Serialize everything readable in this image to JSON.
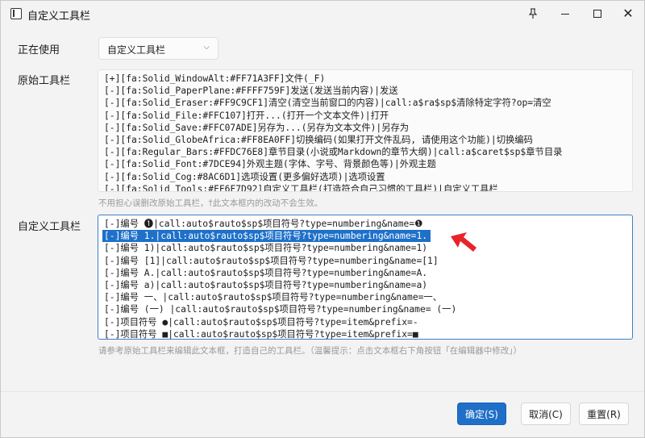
{
  "window": {
    "title": "自定义工具栏"
  },
  "form": {
    "in_use_label": "正在使用",
    "in_use_value": "自定义工具栏",
    "original_label": "原始工具栏",
    "original_lines": [
      "[+][fa:Solid_WindowAlt:#FF71A3FF]文件(_F)",
      "[-][fa:Solid_PaperPlane:#FFFF759F]发送(发送当前内容)|发送",
      "[-][fa:Solid_Eraser:#FF9C9CF1]清空(清空当前窗口的内容)|call:a$ra$sp$清除特定字符?op=清空",
      "[-][fa:Solid_File:#FFC107]打开...(打开一个文本文件)|打开",
      "[-][fa:Solid_Save:#FFC07ADE]另存为...(另存为文本文件)|另存为",
      "[-][fa:Solid_GlobeAfrica:#FF8EA0FF]切换编码(如果打开文件乱码, 请使用这个功能)|切换编码",
      "[-][fa:Regular_Bars:#FFDC76E8]章节目录(小说或Markdown的章节大纲)|call:a$caret$sp$章节目录",
      "[-][fa:Solid_Font:#7DCE94]外观主题(字体、字号、背景颜色等)|外观主题",
      "[-][fa:Solid_Cog:#8AC6D1]选项设置(更多偏好选项)|选项设置",
      "[-][fa:Solid_Tools:#FF6F7D92]自定义工具栏(打造符合自己习惯的工具栏)|自定义工具栏"
    ],
    "original_hint": "不用担心误删改原始工具栏，†此文本框内的改动不会生效。",
    "custom_label": "自定义工具栏",
    "custom_lines": [
      "[-]编号 ❶|call:auto$rauto$sp$项目符号?type=numbering&name=❶",
      "[-]编号 1.|call:auto$rauto$sp$项目符号?type=numbering&name=1.",
      "[-]编号 1)|call:auto$rauto$sp$项目符号?type=numbering&name=1)",
      "[-]编号 [1]|call:auto$rauto$sp$项目符号?type=numbering&name=[1]",
      "[-]编号 A.|call:auto$rauto$sp$项目符号?type=numbering&name=A.",
      "[-]编号 a)|call:auto$rauto$sp$项目符号?type=numbering&name=a)",
      "[-]编号 一、|call:auto$rauto$sp$项目符号?type=numbering&name=一、",
      "[-]编号 (一) |call:auto$rauto$sp$项目符号?type=numbering&name= (一)",
      "[-]项目符号 ●|call:auto$rauto$sp$项目符号?type=item&prefix=-",
      "[-]项目符号 ■|call:auto$rauto$sp$项目符号?type=item&prefix=■"
    ],
    "selected_line_index": 1,
    "custom_hint": "请参考原始工具栏来编辑此文本框，打造自己的工具栏。（温馨提示：点击文本框右下角按钮「在编辑器中修改」）"
  },
  "footer": {
    "ok_label": "确定(S)",
    "cancel_label": "取消(C)",
    "reset_label": "重置(R)"
  },
  "colors": {
    "accent": "#1f6fc8",
    "selection": "#1e70c8",
    "arrow": "#e8232a"
  }
}
